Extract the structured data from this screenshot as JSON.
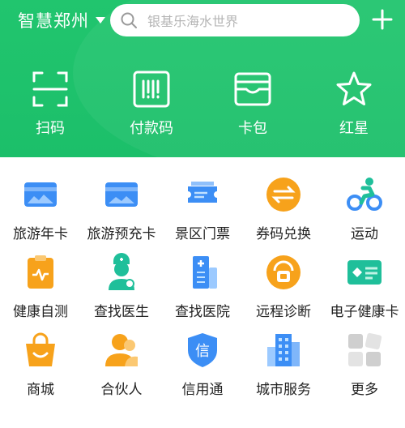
{
  "header": {
    "city": "智慧郑州",
    "search_placeholder": "银基乐海水世界"
  },
  "quick_actions": [
    {
      "label": "扫码",
      "icon": "scan-icon"
    },
    {
      "label": "付款码",
      "icon": "barcode-icon"
    },
    {
      "label": "卡包",
      "icon": "wallet-icon"
    },
    {
      "label": "红星",
      "icon": "star-icon"
    }
  ],
  "services": [
    {
      "label": "旅游年卡",
      "icon": "travel-card-icon"
    },
    {
      "label": "旅游预充卡",
      "icon": "prepaid-card-icon"
    },
    {
      "label": "景区门票",
      "icon": "ticket-icon"
    },
    {
      "label": "券码兑换",
      "icon": "exchange-icon"
    },
    {
      "label": "运动",
      "icon": "cycling-icon"
    },
    {
      "label": "健康自测",
      "icon": "health-test-icon"
    },
    {
      "label": "查找医生",
      "icon": "doctor-icon"
    },
    {
      "label": "查找医院",
      "icon": "hospital-icon"
    },
    {
      "label": "远程诊断",
      "icon": "remote-diagnosis-icon"
    },
    {
      "label": "电子健康卡",
      "icon": "health-card-icon"
    },
    {
      "label": "商城",
      "icon": "shopping-bag-icon"
    },
    {
      "label": "合伙人",
      "icon": "partner-icon"
    },
    {
      "label": "信用通",
      "icon": "credit-shield-icon"
    },
    {
      "label": "城市服务",
      "icon": "city-building-icon"
    },
    {
      "label": "更多",
      "icon": "more-grid-icon"
    }
  ],
  "colors": {
    "header_green": "#1ec36c",
    "icon_blue": "#3c8ef5",
    "icon_orange": "#f7a21b",
    "icon_teal": "#1fbf9a",
    "icon_grey": "#cfcfcf"
  }
}
